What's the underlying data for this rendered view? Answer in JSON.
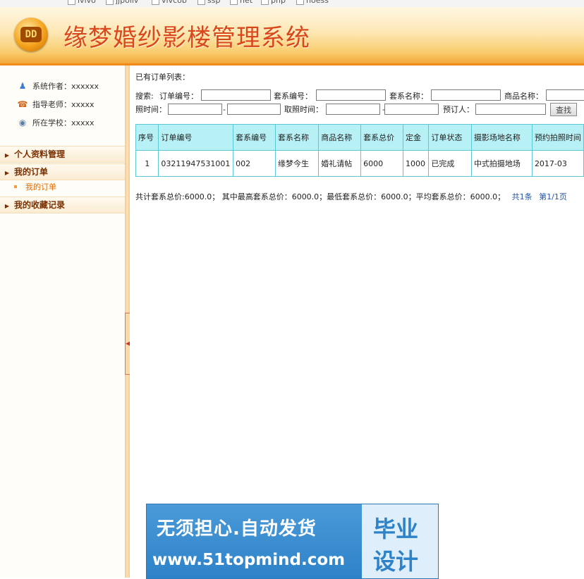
{
  "browser": {
    "bookmarks": [
      "ivivo",
      "jjpoliv",
      "vivcob",
      "ssp",
      "net",
      "php",
      "noess"
    ]
  },
  "header": {
    "logo_text": "DD",
    "title": "缘梦婚纱影楼管理系统"
  },
  "sidebar": {
    "info": [
      {
        "icon": "users-icon",
        "label": "系统作者：xxxxxx"
      },
      {
        "icon": "phone-icon",
        "label": "指导老师：xxxxx"
      },
      {
        "icon": "school-icon",
        "label": "所在学校：xxxxx"
      }
    ],
    "menu": {
      "profile": "个人资料管理",
      "orders": "我的订单",
      "orders_sub": "我的订单",
      "favorites": "我的收藏记录"
    }
  },
  "main": {
    "list_title": "已有订单列表：",
    "search": {
      "label": "搜索:",
      "order_no": "订单编号：",
      "package_no": "套系编号：",
      "package_name": "套系名称：",
      "product_name": "商品名称：",
      "shoot_time": "照时间：",
      "pickup_time": "取照时间：",
      "booker": "预订人：",
      "dash": "-",
      "button": "查找"
    },
    "table": {
      "headers": [
        "序号",
        "订单编号",
        "套系编号",
        "套系名称",
        "商品名称",
        "套系总价",
        "定金",
        "订单状态",
        "摄影场地名称",
        "预约拍照时间"
      ],
      "rows": [
        [
          "1",
          "03211947531001",
          "002",
          "缘梦今生",
          "婚礼请帖",
          "6000",
          "1000",
          "已完成",
          "中式拍摄地场",
          "2017-03"
        ]
      ]
    },
    "summary": {
      "text": "共计套系总价:6000.0； 其中最高套系总价：6000.0；最低套系总价：6000.0；平均套系总价：6000.0；",
      "count": "共1条",
      "page": "第1/1页"
    }
  },
  "banner": {
    "slogan": "无须担心.自动发货",
    "url": "www.51topmind.com",
    "side_line1": "毕业",
    "side_line2": "设计"
  }
}
